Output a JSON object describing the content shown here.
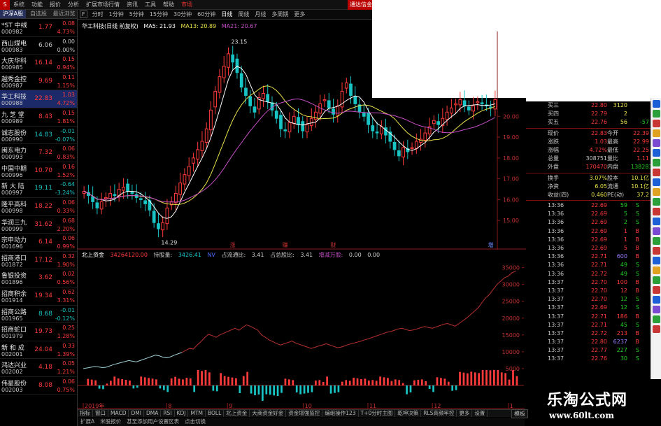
{
  "colors": {
    "up": "#ff3b3b",
    "down": "#19c4c4",
    "even": "#c8c8c8",
    "ma5": "#ffffff",
    "ma13": "#e8e14b",
    "ma21": "#c54ec5",
    "green": "#22cc22"
  },
  "menu": {
    "icon": "S",
    "items": [
      "系统",
      "功能",
      "报价",
      "分析",
      "扩展市场行情",
      "资讯",
      "工具",
      "帮助",
      "市场"
    ],
    "link": "通达信金融终端"
  },
  "watermark": {
    "title": "乐淘公式网",
    "url": "www.60lt.com"
  },
  "sidebar": {
    "tabs": [
      "沪深A股",
      "自选股",
      "最近浏览"
    ],
    "rows": [
      {
        "name": "*ST 中绒",
        "code": "000982",
        "price": "1.77",
        "chg": "0.08",
        "pct": "4.73%",
        "dir": "up"
      },
      {
        "name": "西山煤电",
        "code": "000983",
        "price": "6.06",
        "chg": "0.00",
        "pct": "0.00%",
        "dir": "even"
      },
      {
        "name": "大庆华科",
        "code": "000985",
        "price": "16.14",
        "chg": "0.15",
        "pct": "0.94%",
        "dir": "up"
      },
      {
        "name": "越秀金控",
        "code": "000987",
        "price": "9.69",
        "chg": "0.11",
        "pct": "1.15%",
        "dir": "up"
      },
      {
        "name": "华工科技",
        "code": "000988",
        "price": "22.83",
        "chg": "1.03",
        "pct": "4.72%",
        "dir": "up",
        "selected": true
      },
      {
        "name": "九 芝 堂",
        "code": "000989",
        "price": "8.43",
        "chg": "0.15",
        "pct": "1.81%",
        "dir": "up"
      },
      {
        "name": "诚志股份",
        "code": "000990",
        "price": "14.83",
        "chg": "-0.01",
        "pct": "-0.07%",
        "dir": "down"
      },
      {
        "name": "闽东电力",
        "code": "000993",
        "price": "7.32",
        "chg": "0.06",
        "pct": "0.83%",
        "dir": "up"
      },
      {
        "name": "中国中期",
        "code": "000996",
        "price": "10.70",
        "chg": "0.16",
        "pct": "1.52%",
        "dir": "up"
      },
      {
        "name": "新 大 陆",
        "code": "000997",
        "price": "19.11",
        "chg": "-0.64",
        "pct": "-3.24%",
        "dir": "down"
      },
      {
        "name": "隆平高科",
        "code": "000998",
        "price": "18.22",
        "chg": "0.06",
        "pct": "0.33%",
        "dir": "up"
      },
      {
        "name": "华润三九",
        "code": "000999",
        "price": "31.62",
        "chg": "0.68",
        "pct": "2.20%",
        "dir": "up"
      },
      {
        "name": "宗申动力",
        "code": "001696",
        "price": "6.14",
        "chg": "0.06",
        "pct": "0.99%",
        "dir": "up"
      },
      {
        "name": "招商港口",
        "code": "001872",
        "price": "17.12",
        "chg": "0.32",
        "pct": "1.90%",
        "dir": "up"
      },
      {
        "name": "鲁银投资",
        "code": "001896",
        "price": "3.62",
        "chg": "0.02",
        "pct": "0.56%",
        "dir": "up"
      },
      {
        "name": "招商积余",
        "code": "001914",
        "price": "19.34",
        "chg": "0.62",
        "pct": "3.31%",
        "dir": "up"
      },
      {
        "name": "招商公路",
        "code": "001965",
        "price": "8.68",
        "chg": "-0.01",
        "pct": "-0.12%",
        "dir": "down"
      },
      {
        "name": "招商蛇口",
        "code": "001979",
        "price": "19.73",
        "chg": "0.25",
        "pct": "1.28%",
        "dir": "up"
      },
      {
        "name": "新 和 成",
        "code": "002001",
        "price": "24.04",
        "chg": "0.33",
        "pct": "1.39%",
        "dir": "up"
      },
      {
        "name": "鸿达兴业",
        "code": "002002",
        "price": "4.18",
        "chg": "0.05",
        "pct": "1.21%",
        "dir": "up"
      },
      {
        "name": "伟星股份",
        "code": "002003",
        "price": "8.08",
        "chg": "0.06",
        "pct": "0.75%",
        "dir": "up"
      }
    ]
  },
  "periods": {
    "close_label": "F",
    "items": [
      "分时",
      "1分钟",
      "5分钟",
      "15分钟",
      "30分钟",
      "60分钟",
      "日线",
      "周线",
      "月线",
      "多周期",
      "更多"
    ],
    "active": 6
  },
  "kinfo": {
    "name": "华工科技(日线 前复权)",
    "ma5": "MA5: 21.93",
    "ma13": "MA13: 20.89",
    "ma21": "MA21: 20.67"
  },
  "kchart": {
    "high_label": "23.15",
    "low_label": "14.29",
    "axis": [
      {
        "value": 20,
        "label": "20.00"
      },
      {
        "value": 19,
        "label": "19.00"
      },
      {
        "value": 18,
        "label": "18.00"
      },
      {
        "value": 17,
        "label": "17.00"
      },
      {
        "value": 16,
        "label": "16.00"
      },
      {
        "value": 15,
        "label": "15.00"
      }
    ],
    "markers": [
      {
        "label": "涨",
        "index": 34
      },
      {
        "label": "赚",
        "index": 46
      },
      {
        "label": "财",
        "index": 57
      },
      {
        "label": "增",
        "index": 93
      }
    ],
    "closes": [
      16.4,
      16.2,
      15.9,
      15.6,
      15.9,
      16.1,
      16.3,
      16.2,
      16.5,
      16.6,
      16.4,
      16.3,
      16.1,
      16.0,
      15.8,
      15.5,
      14.9,
      14.6,
      14.9,
      15.6,
      15.9,
      16.3,
      16.8,
      17.2,
      17.6,
      18.0,
      18.4,
      18.8,
      19.4,
      20.3,
      21.2,
      21.9,
      22.4,
      23.0,
      22.6,
      22.1,
      21.4,
      21.0,
      20.5,
      20.2,
      20.9,
      21.1,
      20.7,
      20.3,
      19.9,
      19.4,
      19.3,
      19.7,
      20.0,
      19.6,
      19.3,
      19.6,
      19.9,
      20.2,
      20.6,
      20.8,
      20.4,
      20.1,
      20.5,
      21.2,
      21.6,
      21.0,
      20.6,
      20.2,
      20.0,
      19.6,
      19.3,
      19.2,
      19.5,
      19.1,
      18.8,
      18.4,
      18.1,
      18.5,
      18.3,
      18.5,
      18.8,
      18.9,
      19.2,
      19.5,
      19.8,
      19.6,
      19.9,
      20.2,
      20.4,
      20.6,
      20.8,
      20.5,
      20.3,
      20.5,
      20.7,
      20.6,
      20.5,
      20.4,
      20.8
    ]
  },
  "indicator": {
    "name": "北上资金",
    "value1": "34264120.00",
    "label2": "持股量:",
    "value2": "3426.41",
    "tag": "NV",
    "label3": "占流通比:",
    "value3": "3.41",
    "label4": "占总股比:",
    "value4": "3.41",
    "label5": "增减万股:",
    "value5": "0.00",
    "value6": "0.00"
  },
  "lowchart": {
    "axis": [
      35000,
      30000,
      25000,
      20000,
      15000,
      10000,
      5000
    ],
    "dates": [
      {
        "label": "2019年",
        "index": 0
      },
      {
        "label": "8",
        "index": 22
      },
      {
        "label": "9",
        "index": 38
      },
      {
        "label": "10",
        "index": 58
      },
      {
        "label": "11",
        "index": 75
      },
      {
        "label": "12",
        "index": 92
      },
      {
        "label": "1",
        "index": 112
      }
    ],
    "line": [
      5000,
      5200,
      5400,
      5600,
      5500,
      5300,
      5400,
      5800,
      6200,
      6500,
      6800,
      7100,
      7400,
      7200,
      7000,
      7400,
      7800,
      8200,
      8600,
      9000,
      8800,
      8400,
      8200,
      8500,
      9000,
      9400,
      9800,
      10400,
      11000,
      10800,
      12000,
      13000,
      14200,
      15200,
      14800,
      14300,
      15000,
      15500,
      16000,
      16500,
      17000,
      16400,
      17200,
      18000,
      17600,
      17000,
      16400,
      15000,
      14300,
      13500,
      13000,
      12400,
      12000,
      12400,
      12800,
      13200,
      12600,
      12200,
      11800,
      11400,
      11000,
      11300,
      11700,
      12000,
      12400,
      12000,
      11600,
      11200,
      11400,
      11800,
      12200,
      12500,
      12800,
      13100,
      13500,
      13800,
      14200,
      14600,
      15000,
      15400,
      15800,
      16000,
      16400,
      16800,
      17000,
      16600,
      16300,
      16500,
      16800,
      17200,
      17500,
      17200,
      17000,
      17400,
      17800,
      18200,
      18400,
      18000,
      17600,
      18400,
      19200,
      20000,
      21000,
      22000,
      23000,
      24500,
      26000,
      27000,
      28500,
      30000,
      31000,
      32000,
      32500,
      33500,
      34000
    ]
  },
  "tabs_row1": [
    "指标",
    "窗口",
    "MACD",
    "DMI",
    "DMA",
    "RSI",
    "KDJ",
    "MTM",
    "BOLL",
    "北上资金",
    "大商资金好金",
    "资金增强监控",
    "编组操作123",
    "T+0分时主图",
    "乾坤决策",
    "RLS高频率控",
    "更多",
    "设置"
  ],
  "tabs_row2": [
    "扩展A",
    "米股报价",
    "甚至添加用户设置区表",
    "点击切换"
  ],
  "right_panel": {
    "asks": [
      {
        "label": "买三",
        "price": "22.80",
        "vol": "3120",
        "extra": "",
        "dir": "up"
      },
      {
        "label": "买四",
        "price": "22.79",
        "vol": "2",
        "extra": "",
        "dir": "up"
      },
      {
        "label": "买五",
        "price": "22.76",
        "vol": "56",
        "extra": "-57",
        "dir": "up"
      }
    ],
    "stats": [
      {
        "l1": "现价",
        "v1": "22.83",
        "l2": "今开",
        "v2": "22.39",
        "d1": "up",
        "d2": "up"
      },
      {
        "l1": "涨跌",
        "v1": "1.03",
        "l2": "最高",
        "v2": "22.99",
        "d1": "up",
        "d2": "up"
      },
      {
        "l1": "涨幅",
        "v1": "4.72%",
        "l2": "最低",
        "v2": "22.25",
        "d1": "up",
        "d2": "up"
      },
      {
        "l1": "总量",
        "v1": "308751",
        "l2": "量比",
        "v2": "1.11",
        "d1": "even",
        "d2": "up"
      },
      {
        "l1": "外盘",
        "v1": "170470",
        "l2": "内盘",
        "v2": "138281",
        "d1": "up",
        "d2": "green"
      }
    ],
    "stats2": [
      {
        "l1": "换手",
        "v1": "3.07%",
        "l2": "股本",
        "v2": "10.1亿"
      },
      {
        "l1": "净资",
        "v1": "6.05",
        "l2": "流通",
        "v2": "10.1亿"
      },
      {
        "l1": "收益(四)",
        "v1": "0.460",
        "l2": "PE(动)",
        "v2": "37.2"
      }
    ],
    "ticks": [
      {
        "t": "13:36",
        "p": "22.69",
        "v": "59",
        "bs": "S"
      },
      {
        "t": "13:36",
        "p": "22.69",
        "v": "5",
        "bs": "S"
      },
      {
        "t": "13:36",
        "p": "22.69",
        "v": "2",
        "bs": "S"
      },
      {
        "t": "13:36",
        "p": "22.69",
        "v": "1",
        "bs": "B"
      },
      {
        "t": "13:36",
        "p": "22.69",
        "v": "1",
        "bs": "B"
      },
      {
        "t": "13:36",
        "p": "22.69",
        "v": "5",
        "bs": "B"
      },
      {
        "t": "13:36",
        "p": "22.71",
        "v": "600",
        "bs": "B"
      },
      {
        "t": "13:36",
        "p": "22.71",
        "v": "49",
        "bs": "S"
      },
      {
        "t": "13:36",
        "p": "22.72",
        "v": "49",
        "bs": "S"
      },
      {
        "t": "13:37",
        "p": "22.70",
        "v": "100",
        "bs": "B"
      },
      {
        "t": "13:37",
        "p": "22.70",
        "v": "12",
        "bs": "B"
      },
      {
        "t": "13:37",
        "p": "22.70",
        "v": "12",
        "bs": "S"
      },
      {
        "t": "13:37",
        "p": "22.69",
        "v": "12",
        "bs": "S"
      },
      {
        "t": "13:37",
        "p": "22.71",
        "v": "186",
        "bs": "B"
      },
      {
        "t": "13:37",
        "p": "22.71",
        "v": "45",
        "bs": "S"
      },
      {
        "t": "13:37",
        "p": "22.72",
        "v": "213",
        "bs": "B"
      },
      {
        "t": "13:37",
        "p": "22.80",
        "v": "6237",
        "bs": "B"
      },
      {
        "t": "13:37",
        "p": "22.77",
        "v": "227",
        "bs": "S"
      },
      {
        "t": "13:37",
        "p": "22.76",
        "v": "30",
        "bs": "S"
      }
    ],
    "tab": "模板"
  }
}
